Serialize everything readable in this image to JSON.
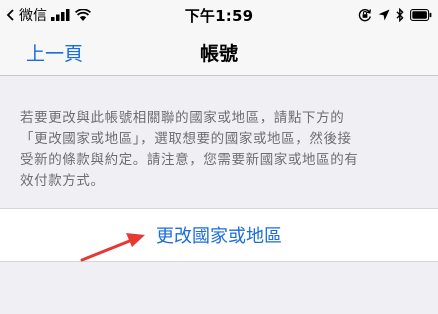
{
  "status_bar": {
    "carrier": "微信",
    "time": "下午1:59"
  },
  "nav": {
    "back_label": "上一頁",
    "title": "帳號"
  },
  "info": {
    "lines": [
      "若要更改與此帳號相關聯的國家或地區，請點下方的",
      "「更改國家或地區」，選取想要的國家或地區，然後接",
      "受新的條款與約定。請注意，您需要新國家或地區的有",
      "效付款方式。"
    ]
  },
  "action": {
    "label": "更改國家或地區"
  },
  "colors": {
    "accent": "#1a6ce1",
    "annotation_arrow": "#e53935"
  },
  "icons": [
    "signal-bars-icon",
    "wifi-icon",
    "rotation-lock-icon",
    "location-icon",
    "bluetooth-icon",
    "battery-icon",
    "annotation-arrow-icon"
  ]
}
